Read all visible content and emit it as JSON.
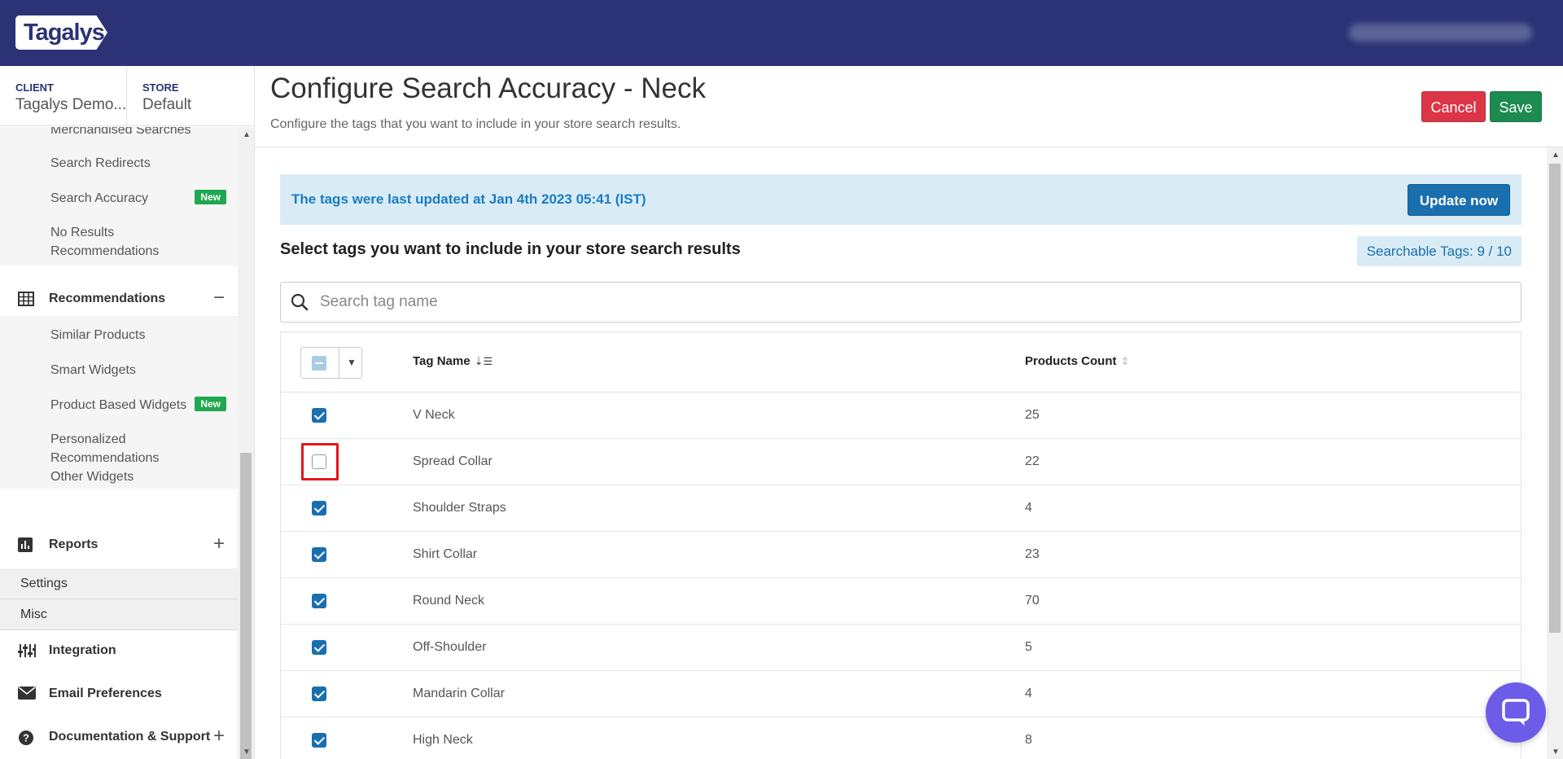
{
  "header": {
    "logo": "Tagalys"
  },
  "sidebar": {
    "client_label": "CLIENT",
    "client_value": "Tagalys Demo...",
    "store_label": "STORE",
    "store_value": "Default",
    "search_items": [
      {
        "label": "Merchandised Searches"
      },
      {
        "label": "Search Redirects"
      },
      {
        "label": "Search Accuracy",
        "badge": "New"
      },
      {
        "label": "No Results Recommendations"
      }
    ],
    "recommendations_label": "Recommendations",
    "recommendations_toggle": "−",
    "recommendation_items": [
      {
        "label": "Similar Products"
      },
      {
        "label": "Smart Widgets"
      },
      {
        "label": "Product Based Widgets",
        "badge": "New"
      },
      {
        "label": "Personalized Recommendations"
      },
      {
        "label": "Other Widgets"
      }
    ],
    "reports_label": "Reports",
    "reports_toggle": "+",
    "settings_label": "Settings",
    "misc_label": "Misc",
    "integration_label": "Integration",
    "email_label": "Email Preferences",
    "docs_label": "Documentation & Support",
    "docs_toggle": "+"
  },
  "page": {
    "title": "Configure Search Accuracy - Neck",
    "subtitle": "Configure the tags that you want to include in your store search results.",
    "cancel_label": "Cancel",
    "save_label": "Save"
  },
  "alert": {
    "text": "The tags were last updated at Jan 4th 2023 05:41 (IST)",
    "button": "Update now"
  },
  "section": {
    "title": "Select tags you want to include in your store search results",
    "searchable": "Searchable Tags: 9 / 10"
  },
  "search": {
    "placeholder": "Search tag name"
  },
  "table": {
    "col_name": "Tag Name",
    "col_count": "Products Count",
    "rows": [
      {
        "name": "V Neck",
        "count": "25",
        "checked": true
      },
      {
        "name": "Spread Collar",
        "count": "22",
        "checked": false
      },
      {
        "name": "Shoulder Straps",
        "count": "4",
        "checked": true
      },
      {
        "name": "Shirt Collar",
        "count": "23",
        "checked": true
      },
      {
        "name": "Round Neck",
        "count": "70",
        "checked": true
      },
      {
        "name": "Off-Shoulder",
        "count": "5",
        "checked": true
      },
      {
        "name": "Mandarin Collar",
        "count": "4",
        "checked": true
      },
      {
        "name": "High Neck",
        "count": "8",
        "checked": true
      }
    ]
  },
  "colors": {
    "header_bg": "#2b3275",
    "primary": "#1a6faf",
    "danger": "#dc3545",
    "success": "#1d8a4f",
    "new_badge": "#1fa84f",
    "highlight": "#e8131b"
  }
}
